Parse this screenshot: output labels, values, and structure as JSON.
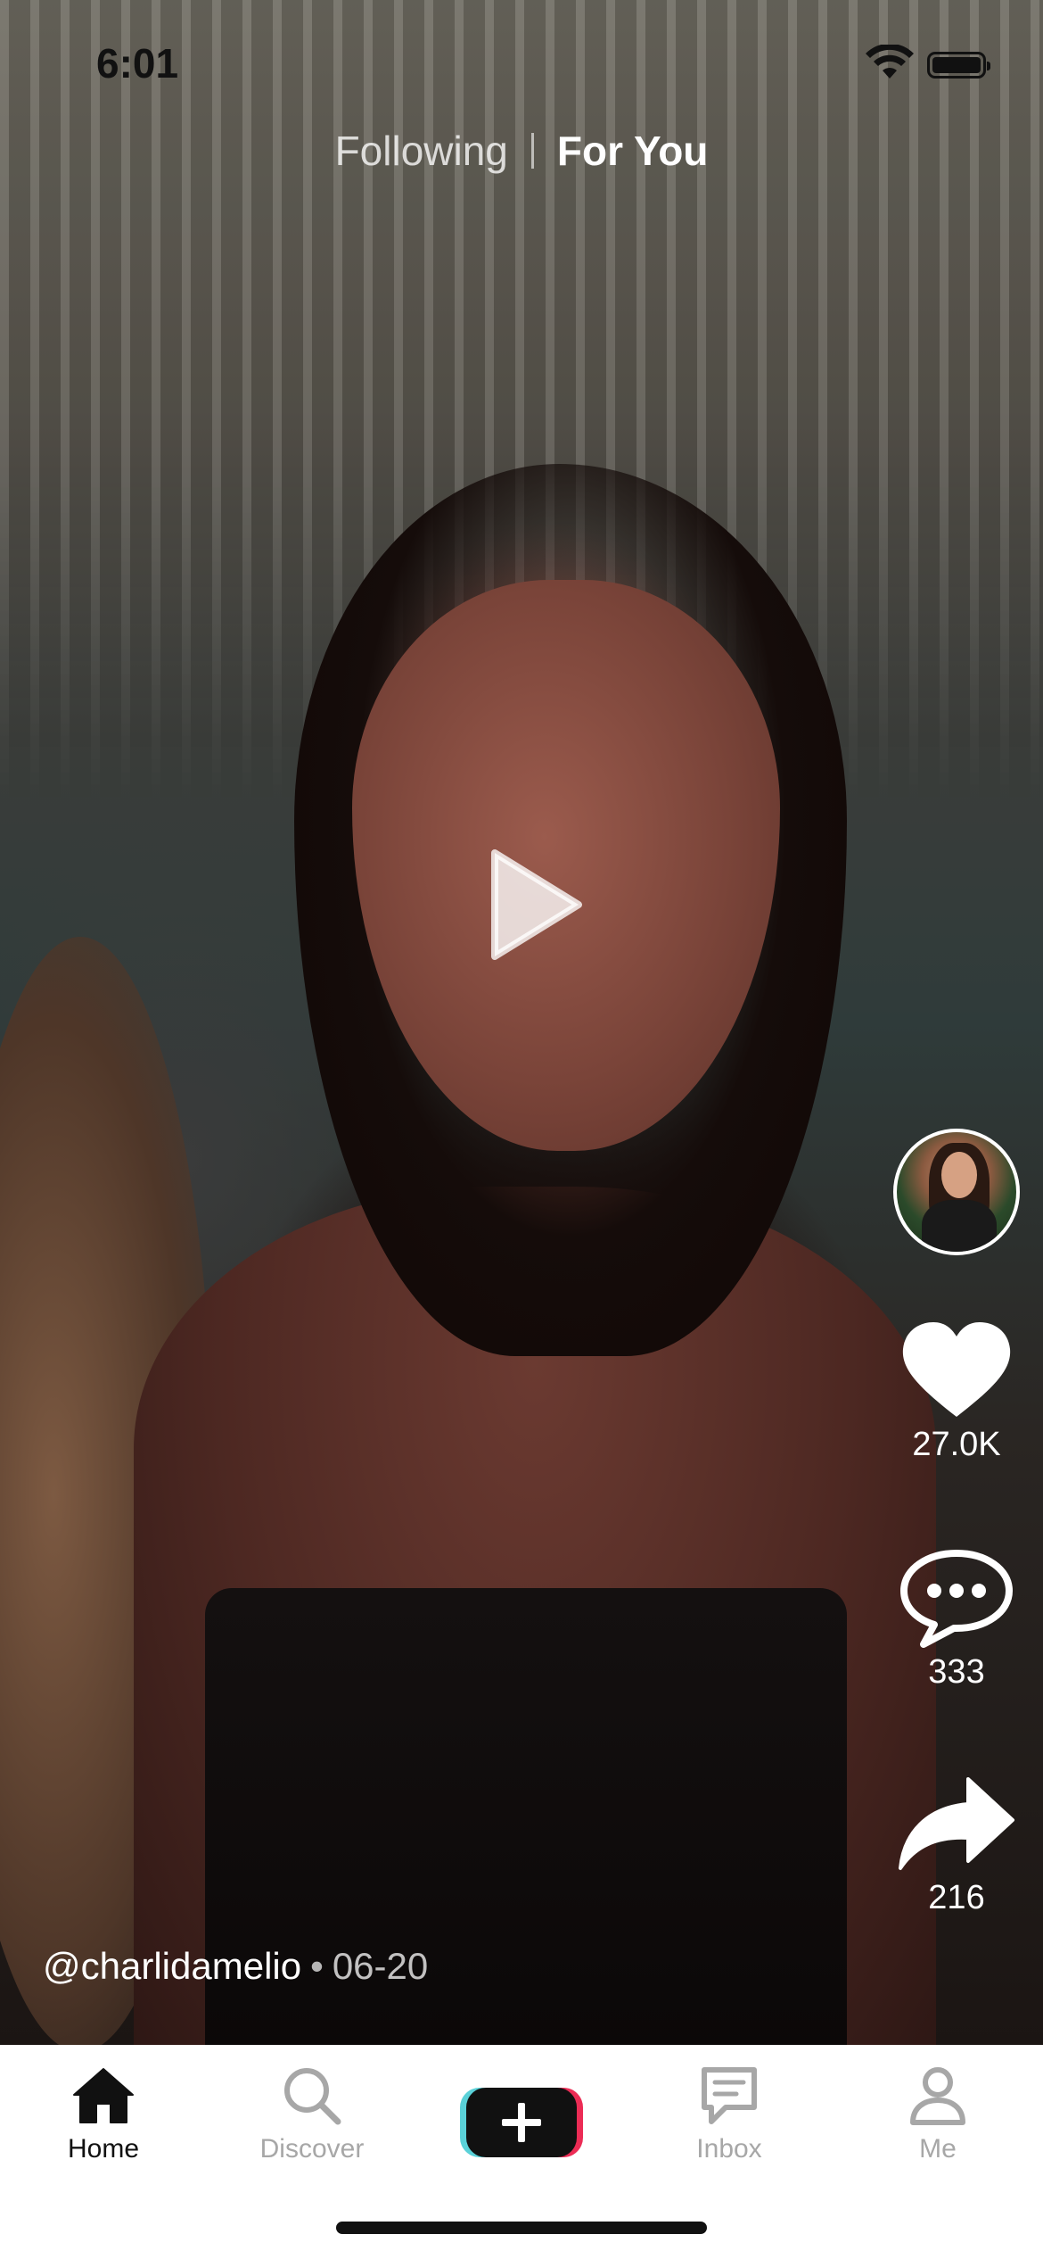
{
  "status_bar": {
    "time": "6:01"
  },
  "feed_tabs": {
    "following": "Following",
    "for_you": "For You",
    "active": "For You"
  },
  "actions": {
    "likes": "27.0K",
    "comments": "333",
    "shares": "216"
  },
  "caption": {
    "username": "@charlidamelio",
    "separator": "•",
    "date": "06-20"
  },
  "tab_bar": {
    "home": "Home",
    "discover": "Discover",
    "inbox": "Inbox",
    "me": "Me",
    "active": "Home"
  },
  "icons": {
    "play": "play-icon",
    "like": "heart-icon",
    "comment": "comment-bubble-icon",
    "share": "share-arrow-icon",
    "home": "home-icon",
    "discover": "search-icon",
    "create": "plus-icon",
    "inbox": "inbox-icon",
    "me": "person-icon"
  },
  "colors": {
    "create_cyan": "#5ad1d8",
    "create_red": "#ec2c55",
    "active_tab": "#111111",
    "inactive_tab": "#a7a7a7"
  }
}
